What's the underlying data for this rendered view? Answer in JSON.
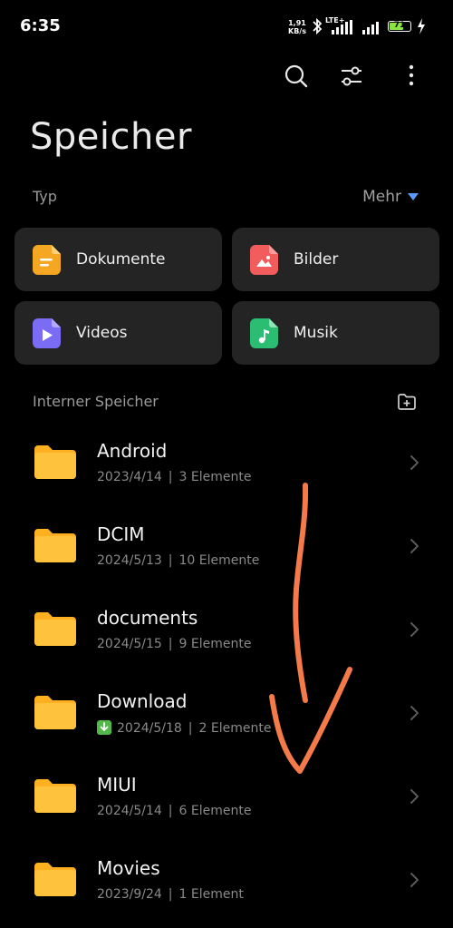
{
  "status_bar": {
    "time": "6:35",
    "net_speed_value": "1,91",
    "net_speed_unit": "KB/s",
    "network_type": "LTE+",
    "battery_level": "71",
    "battery_fill_percent": 71
  },
  "toolbar": {
    "icons": [
      "search-icon",
      "filter-sliders-icon",
      "more-vertical-icon"
    ]
  },
  "page": {
    "title": "Speicher"
  },
  "type_section": {
    "label": "Typ",
    "more_label": "Mehr",
    "categories": [
      {
        "label": "Dokumente",
        "icon": "document-icon",
        "color": "#F5A623"
      },
      {
        "label": "Bilder",
        "icon": "image-icon",
        "color": "#F25C5C"
      },
      {
        "label": "Videos",
        "icon": "video-icon",
        "color": "#7B6CF6"
      },
      {
        "label": "Musik",
        "icon": "music-icon",
        "color": "#2BBE73"
      }
    ]
  },
  "storage_section": {
    "label": "Interner Speicher",
    "folders": [
      {
        "name": "Android",
        "date": "2023/4/14",
        "items": "3 Elemente",
        "download_badge": false
      },
      {
        "name": "DCIM",
        "date": "2024/5/13",
        "items": "10 Elemente",
        "download_badge": false
      },
      {
        "name": "documents",
        "date": "2024/5/15",
        "items": "9 Elemente",
        "download_badge": false
      },
      {
        "name": "Download",
        "date": "2024/5/18",
        "items": "2 Elemente",
        "download_badge": true
      },
      {
        "name": "MIUI",
        "date": "2024/5/14",
        "items": "6 Elemente",
        "download_badge": false
      },
      {
        "name": "Movies",
        "date": "2023/9/24",
        "items": "1 Element",
        "download_badge": false
      }
    ]
  },
  "colors": {
    "background": "#000000",
    "card": "#242424",
    "folder": "#FFB020",
    "annotation_stroke": "#F47A4A",
    "accent": "#5B9BFF"
  }
}
